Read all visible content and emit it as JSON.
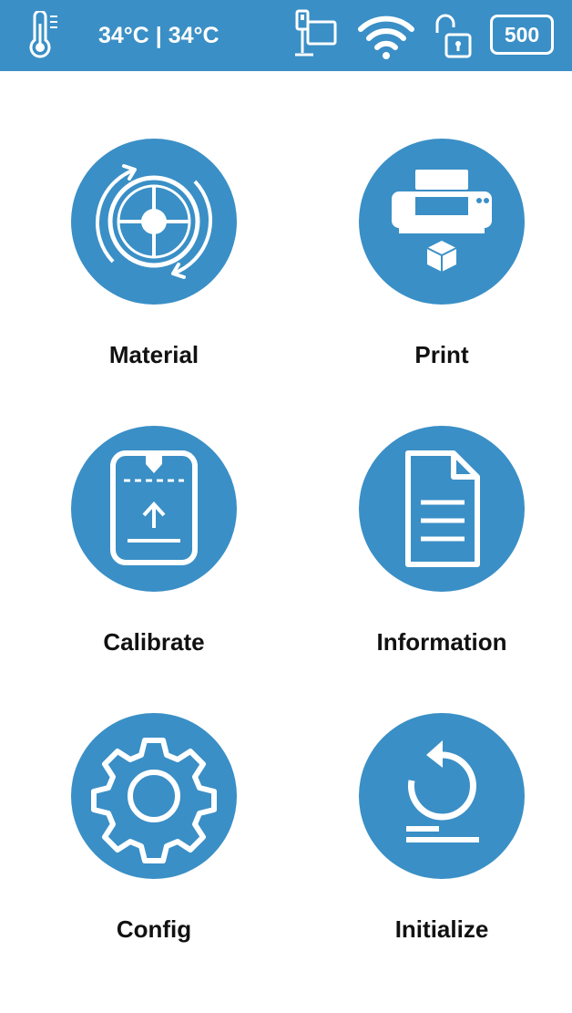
{
  "status_bar": {
    "temperature": "34°C | 34°C",
    "badge": "500",
    "icons": [
      "thermometer-icon",
      "network-icon",
      "wifi-icon",
      "unlock-icon"
    ]
  },
  "menu": {
    "items": [
      {
        "label": "Material",
        "icon": "material-rotate-icon"
      },
      {
        "label": "Print",
        "icon": "printer-icon"
      },
      {
        "label": "Calibrate",
        "icon": "calibrate-icon"
      },
      {
        "label": "Information",
        "icon": "document-icon"
      },
      {
        "label": "Config",
        "icon": "gear-icon"
      },
      {
        "label": "Initialize",
        "icon": "reset-icon"
      }
    ]
  },
  "colors": {
    "accent": "#3a8fc6",
    "text": "#111111",
    "background": "#ffffff"
  }
}
